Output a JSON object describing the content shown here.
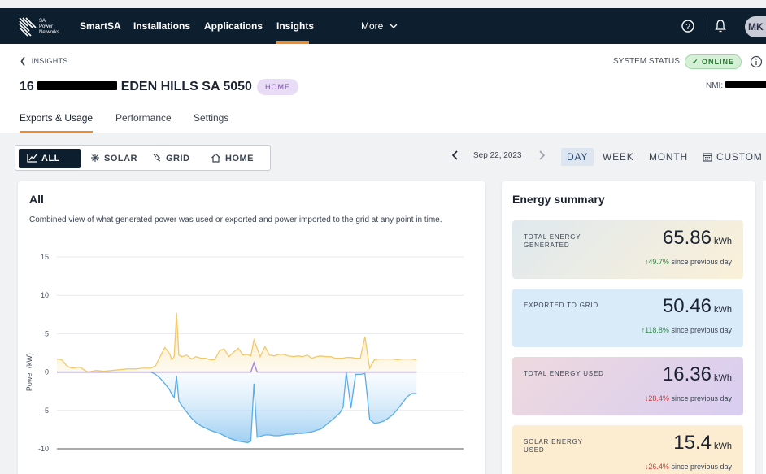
{
  "nav": {
    "brand_line1": "SA",
    "brand_line2": "Power",
    "brand_line3": "Networks",
    "items": [
      {
        "label": "SmartSA"
      },
      {
        "label": "Installations"
      },
      {
        "label": "Applications"
      },
      {
        "label": "Insights"
      }
    ],
    "more_label": "More",
    "avatar_initials": "MK"
  },
  "header": {
    "breadcrumb": "INSIGHTS",
    "address_prefix": "16",
    "address_suffix": "EDEN HILLS SA 5050",
    "site_badge": "HOME",
    "system_status_label": "SYSTEM STATUS:",
    "system_status_value": "ONLINE",
    "nmi_label": "NMI:",
    "tabs": [
      {
        "label": "Exports & Usage"
      },
      {
        "label": "Performance"
      },
      {
        "label": "Settings"
      }
    ]
  },
  "filters": {
    "views": [
      {
        "label": "ALL"
      },
      {
        "label": "SOLAR"
      },
      {
        "label": "GRID"
      },
      {
        "label": "HOME"
      }
    ],
    "date": "Sep 22, 2023",
    "periods": [
      {
        "label": "DAY"
      },
      {
        "label": "WEEK"
      },
      {
        "label": "MONTH"
      },
      {
        "label": "CUSTOM"
      }
    ]
  },
  "chart_card": {
    "title": "All",
    "description": "Combined view of what generated power was used or exported and power imported to the grid at any point in time."
  },
  "chart_data": {
    "type": "area",
    "title": "All",
    "ylabel": "Power (kW)",
    "xlabel": "",
    "ylim": [
      -10,
      15
    ],
    "yticks": [
      15,
      10,
      5,
      0,
      -5,
      -10
    ],
    "grid": true,
    "x": [
      0,
      0.3,
      0.6,
      0.8,
      1,
      1.3,
      1.5,
      1.8,
      2,
      2.5,
      3,
      3.5,
      4,
      4.5,
      5,
      5.5,
      6,
      6.3,
      6.6,
      6.9,
      7.2,
      7.35,
      7.5,
      7.65,
      7.8,
      8,
      8.3,
      8.6,
      8.9,
      9.2,
      9.5,
      9.8,
      10.1,
      10.4,
      10.7,
      11,
      11.3,
      11.6,
      11.9,
      12.2,
      12.4,
      12.6,
      12.8,
      13,
      13.3,
      13.6,
      13.9,
      14.2,
      14.5,
      14.8,
      15.1,
      15.4,
      15.7,
      16,
      16.3,
      16.6,
      16.9,
      17.2,
      17.5,
      17.8,
      18.1,
      18.3,
      18.5,
      18.8,
      19.1,
      19.4,
      19.7,
      20,
      20.3,
      20.6,
      20.9,
      21.2,
      21.5,
      21.8,
      22.1,
      22.4,
      22.7,
      23
    ],
    "series": [
      {
        "values": [
          1.7,
          1.6,
          0.9,
          0.6,
          0.5,
          0.6,
          0.6,
          0.2,
          0,
          0.2,
          0.1,
          0.2,
          0.3,
          0.4,
          0.4,
          0.5,
          0.5,
          0.8,
          2,
          3.2,
          2.4,
          1.6,
          2,
          7.7,
          2.2,
          2,
          2.2,
          1.7,
          2,
          1.8,
          1.8,
          1.6,
          1.6,
          2.8,
          3,
          2,
          2.6,
          3.1,
          2.2,
          2.3,
          2.1,
          4.2,
          3.1,
          2,
          3.3,
          2.2,
          2.1,
          2.3,
          2.3,
          2.1,
          2,
          2.1,
          2,
          2.2,
          1.8,
          2,
          2.1,
          2,
          2,
          1.8,
          1.8,
          1.8,
          1.9,
          1.9,
          1.8,
          1.8,
          4.6,
          0.5,
          1.6,
          1.7,
          1.7,
          1.7,
          1.7,
          1.6,
          1.7,
          1.7,
          1.7,
          1.6
        ]
      },
      {
        "values": [
          0,
          0,
          0,
          0,
          0,
          0,
          0,
          0,
          0,
          0,
          0,
          0,
          0,
          0,
          0,
          0,
          0,
          -0.3,
          -0.8,
          -1.5,
          -2.3,
          -2.9,
          -3.3,
          -0.5,
          -3.8,
          -4.4,
          -5.2,
          -6,
          -6.6,
          -7,
          -7.3,
          -7.6,
          -7.8,
          -8,
          -8.3,
          -8.6,
          -8.8,
          -9,
          -9.1,
          -9.2,
          -9,
          -1.5,
          -8.5,
          -8.4,
          -8.2,
          -8.2,
          -8.3,
          -8.3,
          -8.2,
          -8.1,
          -8.1,
          -8,
          -8,
          -7.9,
          -7.8,
          -7.6,
          -7.4,
          -6.9,
          -6.4,
          -5.9,
          -5.3,
          -4.6,
          0,
          -4.7,
          -0.3,
          -0.3,
          -0.2,
          -6.2,
          -6.7,
          -6.6,
          -6.4,
          -6,
          -5.5,
          -4.8,
          -4,
          -3.2,
          -2.8,
          -2.8
        ]
      },
      {
        "values": [
          0,
          0,
          0,
          0,
          0,
          0,
          0,
          0,
          0,
          0,
          0,
          0,
          0,
          0,
          0,
          0,
          0,
          0,
          0,
          0,
          0,
          0,
          0,
          0,
          0,
          0,
          0,
          0,
          0,
          0,
          0,
          0,
          0,
          0,
          0,
          0,
          0,
          0,
          0,
          0,
          0,
          1.2,
          0,
          0,
          0,
          0,
          0,
          0,
          0,
          0,
          0,
          0,
          0,
          0,
          0,
          0,
          0,
          0,
          0,
          0,
          0,
          0,
          0,
          0,
          0,
          0,
          0,
          0,
          0,
          0,
          0,
          0,
          0,
          0,
          0,
          0,
          0,
          0
        ]
      }
    ],
    "colors": {
      "generated": "#f2c96a",
      "exported": "#5aaee8",
      "imported": "#a98ce0"
    }
  },
  "summary": {
    "title": "Energy summary",
    "tiles": [
      {
        "label": "TOTAL ENERGY GENERATED",
        "value": "65.86",
        "unit": "kWh",
        "arrow": "↑",
        "change": "49.7%",
        "since": "since previous day"
      },
      {
        "label": "EXPORTED TO GRID",
        "value": "50.46",
        "unit": "kWh",
        "arrow": "↑",
        "change": "118.8%",
        "since": "since previous day"
      },
      {
        "label": "TOTAL ENERGY USED",
        "value": "16.36",
        "unit": "kWh",
        "arrow": "↓",
        "change": "28.4%",
        "since": "since previous day"
      },
      {
        "label": "SOLAR ENERGY USED",
        "value": "15.4",
        "unit": "kWh",
        "arrow": "↓",
        "change": "26.4%",
        "since": "since previous day"
      }
    ]
  }
}
